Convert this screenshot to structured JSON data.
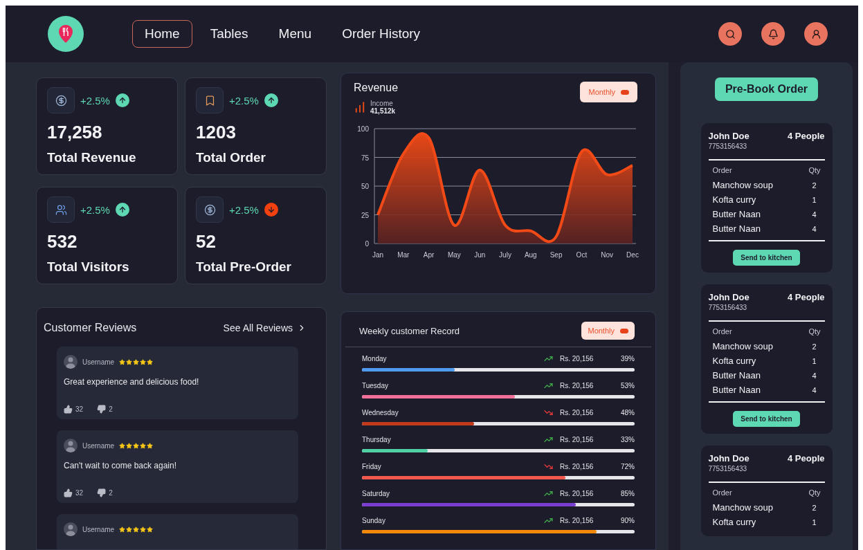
{
  "nav": {
    "tabs": [
      {
        "label": "Home",
        "selected": true
      },
      {
        "label": "Tables",
        "selected": false
      },
      {
        "label": "Menu",
        "selected": false
      },
      {
        "label": "Order History",
        "selected": false
      }
    ]
  },
  "stats": [
    {
      "kind": "dollar",
      "change": "+2.5%",
      "rising": true,
      "value": "17,258",
      "label": "Total Revenue"
    },
    {
      "kind": "bookmark",
      "change": "+2.5%",
      "rising": true,
      "value": "1203",
      "label": "Total Order"
    },
    {
      "kind": "users",
      "change": "+2.5%",
      "rising": true,
      "value": "532",
      "label": "Total Visitors"
    },
    {
      "kind": "dollar",
      "change": "+2.5%",
      "rising": false,
      "value": "52",
      "label": "Total Pre-Order"
    }
  ],
  "revenue": {
    "period": "Monthly",
    "total": "41,512k",
    "chart_data": {
      "type": "area",
      "title": "Revenue",
      "categories": [
        "Jan",
        "Mar",
        "Apr",
        "May",
        "Jun",
        "July",
        "Aug",
        "Sep",
        "Oct",
        "Nov",
        "Dec"
      ],
      "ylim": [
        0,
        100
      ],
      "grid": true,
      "yticks": [
        0,
        25,
        50,
        75,
        100
      ],
      "series": [
        {
          "name": "Income",
          "color": "#f24a16",
          "values": [
            25,
            78,
            92,
            16,
            64,
            16,
            11,
            6,
            80,
            60,
            68
          ]
        }
      ]
    }
  },
  "reviews": {
    "title": "Customer Reviews",
    "link": "See All Reviews",
    "items": [
      {
        "user": "Username",
        "stars": 5,
        "text": "Great experience and delicious food!",
        "likes": "32",
        "dislikes": "2"
      },
      {
        "user": "Username",
        "stars": 5,
        "text": "Can't wait to come back again!",
        "likes": "32",
        "dislikes": "2"
      },
      {
        "user": "Username",
        "stars": 5
      }
    ]
  },
  "weekly": {
    "title": "Weekly customer Record",
    "period": "Monthly",
    "rows": [
      {
        "day": "Monday",
        "rising": true,
        "amount": "Rs. 20,156",
        "percent": "39%",
        "level": 0.34,
        "color": "#4f9bf0"
      },
      {
        "day": "Tuesday",
        "rising": true,
        "amount": "Rs. 20,156",
        "percent": "53%",
        "level": 0.56,
        "color": "#f0709a"
      },
      {
        "day": "Wednesday",
        "rising": false,
        "amount": "Rs. 20,156",
        "percent": "48%",
        "level": 0.41,
        "color": "#c2391c"
      },
      {
        "day": "Thursday",
        "rising": true,
        "amount": "Rs. 20,156",
        "percent": "33%",
        "level": 0.24,
        "color": "#4fd1a5"
      },
      {
        "day": "Friday",
        "rising": false,
        "amount": "Rs. 20,156",
        "percent": "72%",
        "level": 0.745,
        "color": "#f2584c"
      },
      {
        "day": "Saturday",
        "rising": true,
        "amount": "Rs. 20,156",
        "percent": "85%",
        "level": 0.785,
        "color": "#7a3fd0"
      },
      {
        "day": "Sunday",
        "rising": true,
        "amount": "Rs. 20,156",
        "percent": "90%",
        "level": 0.86,
        "color": "#f58a0a"
      }
    ]
  },
  "prebook": {
    "button": "Pre-Book Order",
    "orders": [
      {
        "name": "John Doe",
        "people": "4 People",
        "phone": "7753156433",
        "order_header": "Order",
        "qty_header": "Qty",
        "items": [
          {
            "name": "Manchow soup",
            "qty": "2"
          },
          {
            "name": "Kofta curry",
            "qty": "1"
          },
          {
            "name": "Butter Naan",
            "qty": "4"
          },
          {
            "name": "Butter Naan",
            "qty": "4"
          }
        ],
        "action": "Send to kitchen"
      },
      {
        "name": "John Doe",
        "people": "4 People",
        "phone": "7753156433",
        "order_header": "Order",
        "qty_header": "Qty",
        "items": [
          {
            "name": "Manchow soup",
            "qty": "2"
          },
          {
            "name": "Kofta curry",
            "qty": "1"
          },
          {
            "name": "Butter Naan",
            "qty": "4"
          },
          {
            "name": "Butter Naan",
            "qty": "4"
          }
        ],
        "action": "Send to kitchen"
      },
      {
        "name": "John Doe",
        "people": "4 People",
        "phone": "7753156433",
        "order_header": "Order",
        "qty_header": "Qty",
        "items": [
          {
            "name": "Manchow soup",
            "qty": "2"
          },
          {
            "name": "Kofta curry",
            "qty": "1"
          }
        ]
      }
    ]
  }
}
